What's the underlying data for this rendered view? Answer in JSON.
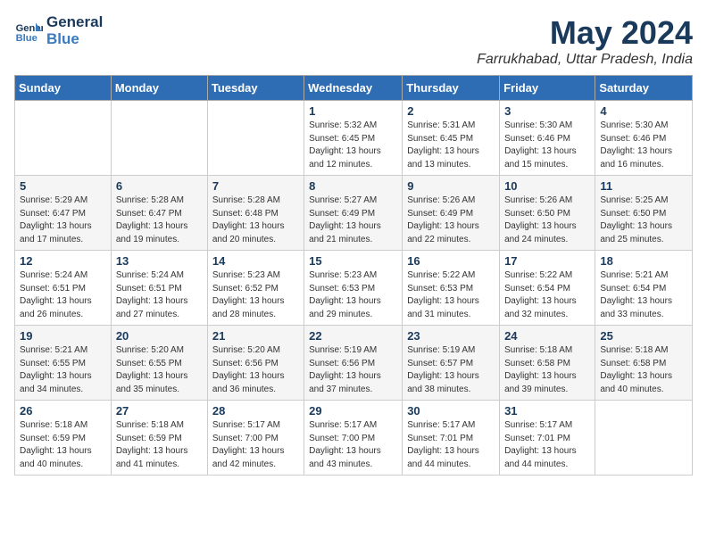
{
  "logo": {
    "line1": "General",
    "line2": "Blue"
  },
  "title": "May 2024",
  "location": "Farrukhabad, Uttar Pradesh, India",
  "weekdays": [
    "Sunday",
    "Monday",
    "Tuesday",
    "Wednesday",
    "Thursday",
    "Friday",
    "Saturday"
  ],
  "weeks": [
    [
      {
        "day": "",
        "info": ""
      },
      {
        "day": "",
        "info": ""
      },
      {
        "day": "",
        "info": ""
      },
      {
        "day": "1",
        "info": "Sunrise: 5:32 AM\nSunset: 6:45 PM\nDaylight: 13 hours\nand 12 minutes."
      },
      {
        "day": "2",
        "info": "Sunrise: 5:31 AM\nSunset: 6:45 PM\nDaylight: 13 hours\nand 13 minutes."
      },
      {
        "day": "3",
        "info": "Sunrise: 5:30 AM\nSunset: 6:46 PM\nDaylight: 13 hours\nand 15 minutes."
      },
      {
        "day": "4",
        "info": "Sunrise: 5:30 AM\nSunset: 6:46 PM\nDaylight: 13 hours\nand 16 minutes."
      }
    ],
    [
      {
        "day": "5",
        "info": "Sunrise: 5:29 AM\nSunset: 6:47 PM\nDaylight: 13 hours\nand 17 minutes."
      },
      {
        "day": "6",
        "info": "Sunrise: 5:28 AM\nSunset: 6:47 PM\nDaylight: 13 hours\nand 19 minutes."
      },
      {
        "day": "7",
        "info": "Sunrise: 5:28 AM\nSunset: 6:48 PM\nDaylight: 13 hours\nand 20 minutes."
      },
      {
        "day": "8",
        "info": "Sunrise: 5:27 AM\nSunset: 6:49 PM\nDaylight: 13 hours\nand 21 minutes."
      },
      {
        "day": "9",
        "info": "Sunrise: 5:26 AM\nSunset: 6:49 PM\nDaylight: 13 hours\nand 22 minutes."
      },
      {
        "day": "10",
        "info": "Sunrise: 5:26 AM\nSunset: 6:50 PM\nDaylight: 13 hours\nand 24 minutes."
      },
      {
        "day": "11",
        "info": "Sunrise: 5:25 AM\nSunset: 6:50 PM\nDaylight: 13 hours\nand 25 minutes."
      }
    ],
    [
      {
        "day": "12",
        "info": "Sunrise: 5:24 AM\nSunset: 6:51 PM\nDaylight: 13 hours\nand 26 minutes."
      },
      {
        "day": "13",
        "info": "Sunrise: 5:24 AM\nSunset: 6:51 PM\nDaylight: 13 hours\nand 27 minutes."
      },
      {
        "day": "14",
        "info": "Sunrise: 5:23 AM\nSunset: 6:52 PM\nDaylight: 13 hours\nand 28 minutes."
      },
      {
        "day": "15",
        "info": "Sunrise: 5:23 AM\nSunset: 6:53 PM\nDaylight: 13 hours\nand 29 minutes."
      },
      {
        "day": "16",
        "info": "Sunrise: 5:22 AM\nSunset: 6:53 PM\nDaylight: 13 hours\nand 31 minutes."
      },
      {
        "day": "17",
        "info": "Sunrise: 5:22 AM\nSunset: 6:54 PM\nDaylight: 13 hours\nand 32 minutes."
      },
      {
        "day": "18",
        "info": "Sunrise: 5:21 AM\nSunset: 6:54 PM\nDaylight: 13 hours\nand 33 minutes."
      }
    ],
    [
      {
        "day": "19",
        "info": "Sunrise: 5:21 AM\nSunset: 6:55 PM\nDaylight: 13 hours\nand 34 minutes."
      },
      {
        "day": "20",
        "info": "Sunrise: 5:20 AM\nSunset: 6:55 PM\nDaylight: 13 hours\nand 35 minutes."
      },
      {
        "day": "21",
        "info": "Sunrise: 5:20 AM\nSunset: 6:56 PM\nDaylight: 13 hours\nand 36 minutes."
      },
      {
        "day": "22",
        "info": "Sunrise: 5:19 AM\nSunset: 6:56 PM\nDaylight: 13 hours\nand 37 minutes."
      },
      {
        "day": "23",
        "info": "Sunrise: 5:19 AM\nSunset: 6:57 PM\nDaylight: 13 hours\nand 38 minutes."
      },
      {
        "day": "24",
        "info": "Sunrise: 5:18 AM\nSunset: 6:58 PM\nDaylight: 13 hours\nand 39 minutes."
      },
      {
        "day": "25",
        "info": "Sunrise: 5:18 AM\nSunset: 6:58 PM\nDaylight: 13 hours\nand 40 minutes."
      }
    ],
    [
      {
        "day": "26",
        "info": "Sunrise: 5:18 AM\nSunset: 6:59 PM\nDaylight: 13 hours\nand 40 minutes."
      },
      {
        "day": "27",
        "info": "Sunrise: 5:18 AM\nSunset: 6:59 PM\nDaylight: 13 hours\nand 41 minutes."
      },
      {
        "day": "28",
        "info": "Sunrise: 5:17 AM\nSunset: 7:00 PM\nDaylight: 13 hours\nand 42 minutes."
      },
      {
        "day": "29",
        "info": "Sunrise: 5:17 AM\nSunset: 7:00 PM\nDaylight: 13 hours\nand 43 minutes."
      },
      {
        "day": "30",
        "info": "Sunrise: 5:17 AM\nSunset: 7:01 PM\nDaylight: 13 hours\nand 44 minutes."
      },
      {
        "day": "31",
        "info": "Sunrise: 5:17 AM\nSunset: 7:01 PM\nDaylight: 13 hours\nand 44 minutes."
      },
      {
        "day": "",
        "info": ""
      }
    ]
  ]
}
